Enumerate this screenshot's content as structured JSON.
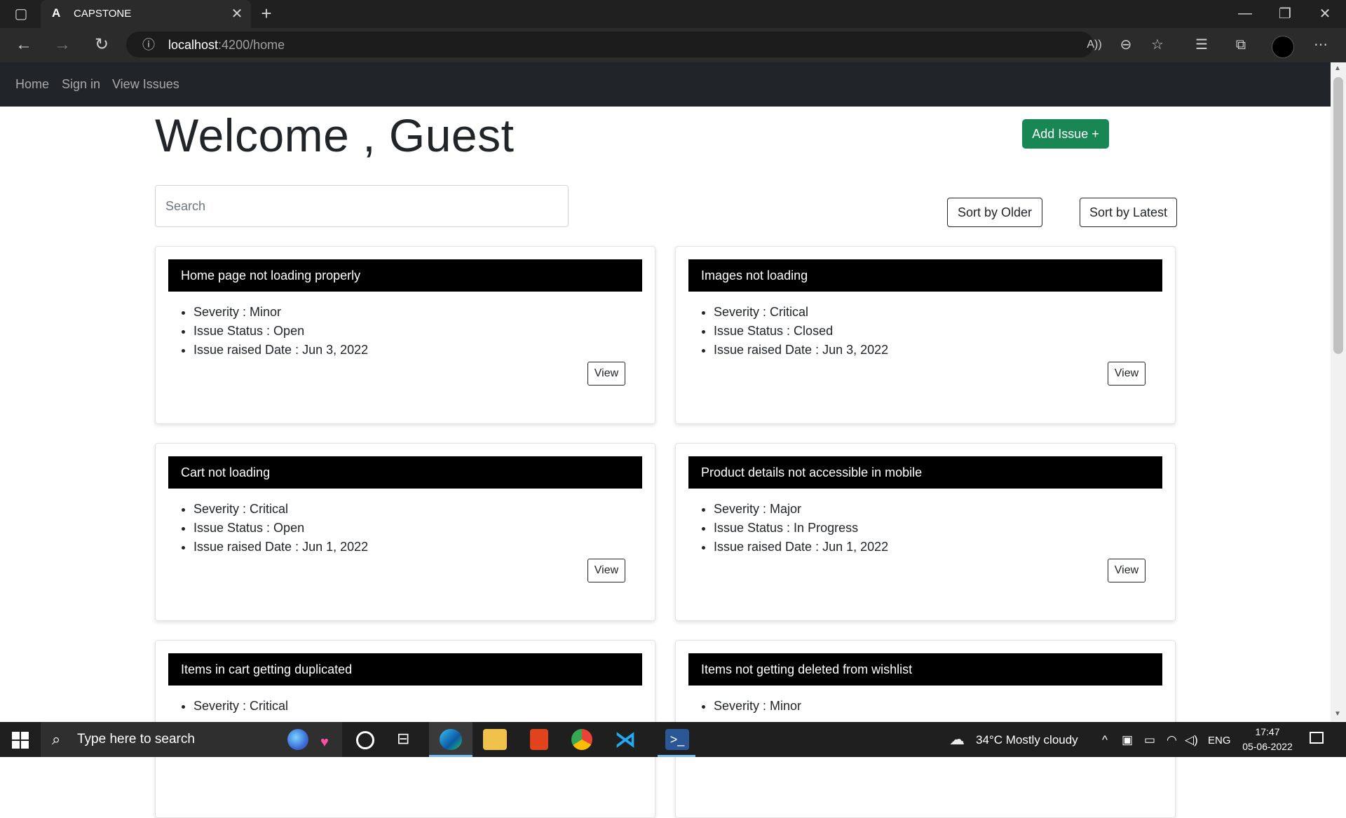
{
  "browser": {
    "tab_title": "CAPSTONE",
    "url_host": "localhost",
    "url_path": ":4200/home"
  },
  "nav": {
    "items": [
      "Home",
      "Sign in",
      "View Issues"
    ]
  },
  "page": {
    "welcome": "Welcome , Guest",
    "add_issue": "Add Issue +",
    "search_placeholder": "Search",
    "sort_older": "Sort by Older",
    "sort_latest": "Sort by Latest",
    "view_label": "View"
  },
  "issues": [
    {
      "title": "Home page not loading properly",
      "severity": "Severity : Minor",
      "status": "Issue Status : Open",
      "date": "Issue raised Date : Jun 3, 2022"
    },
    {
      "title": "Images not loading",
      "severity": "Severity : Critical",
      "status": "Issue Status : Closed",
      "date": "Issue raised Date : Jun 3, 2022"
    },
    {
      "title": "Cart not loading",
      "severity": "Severity : Critical",
      "status": "Issue Status : Open",
      "date": "Issue raised Date : Jun 1, 2022"
    },
    {
      "title": "Product details not accessible in mobile",
      "severity": "Severity : Major",
      "status": "Issue Status : In Progress",
      "date": "Issue raised Date : Jun 1, 2022"
    },
    {
      "title": "Items in cart getting duplicated",
      "severity": "Severity : Critical",
      "status": "",
      "date": ""
    },
    {
      "title": "Items not getting deleted from wishlist",
      "severity": "Severity : Minor",
      "status": "",
      "date": ""
    }
  ],
  "taskbar": {
    "search_placeholder": "Type here to search",
    "weather": "34°C  Mostly cloudy",
    "lang": "ENG",
    "time": "17:47",
    "date": "05-06-2022"
  },
  "colors": {
    "accent_green": "#198754",
    "nav_bg": "#212529",
    "card_header_bg": "#000000"
  }
}
